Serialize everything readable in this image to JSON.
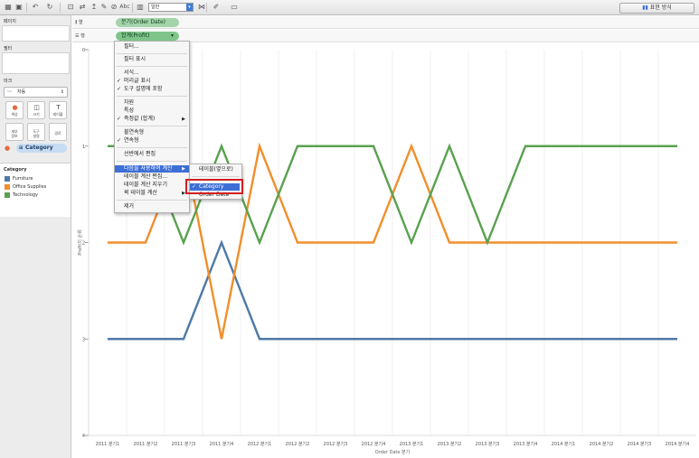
{
  "toolbar": {
    "icons": [
      "data-source-icon",
      "save-icon",
      "undo-icon",
      "redo-icon",
      "new-sheet-icon",
      "swap-icon",
      "sort-asc-icon",
      "sort-desc-icon",
      "highlight-icon",
      "group-icon",
      "label-icon",
      "fit-icon",
      "text-abc-icon",
      "tooltip-icon",
      "pin-icon",
      "pen-icon",
      "presentation-icon"
    ],
    "abc": "Abc",
    "fit_select": "일반",
    "show_me": "표현 방식"
  },
  "left": {
    "pages_title": "페이지",
    "filters_title": "필터",
    "marks_title": "마크",
    "mark_type": "자동",
    "mark_buttons": [
      "색상",
      "크기",
      "레이블",
      "세부\n정보",
      "도구\n설명",
      "경로"
    ],
    "category_pill": "Category",
    "legend_title": "Category",
    "legend": [
      {
        "label": "Furniture",
        "color": "#4e79a7"
      },
      {
        "label": "Office Supplies",
        "color": "#f28e2b"
      },
      {
        "label": "Technology",
        "color": "#59a14f"
      }
    ]
  },
  "shelves": {
    "columns_label": "열",
    "rows_label": "행",
    "columns_pill": "분기(Order Date)",
    "rows_pill": "합계(Profit)",
    "rows_pill_delta": "Δ"
  },
  "menu": {
    "items": [
      "필터...",
      "필터 표시",
      "서식...",
      "머리글 표시",
      "도구 설명에 포함",
      "차원",
      "특성",
      "측정값 (합계)",
      "불연속형",
      "연속형",
      "선반에서 편집",
      "다음을 사용하여 계산",
      "테이블 계산 편집...",
      "테이블 계산 지우기",
      "퀵 테이블 계산",
      "제거"
    ],
    "submenu": [
      "테이블(옆으로)",
      "Category",
      "Order Date"
    ]
  },
  "chart_data": {
    "type": "line",
    "categories": [
      "2011 분기1",
      "2011 분기2",
      "2011 분기3",
      "2011 분기4",
      "2012 분기1",
      "2012 분기2",
      "2012 분기3",
      "2012 분기4",
      "2013 분기1",
      "2013 분기2",
      "2013 분기3",
      "2013 분기4",
      "2014 분기1",
      "2014 분기2",
      "2014 분기3",
      "2014 분기4"
    ],
    "series": [
      {
        "name": "Furniture",
        "color": "#4e79a7",
        "values": [
          3,
          3,
          3,
          2,
          3,
          3,
          3,
          3,
          3,
          3,
          3,
          3,
          3,
          3,
          3,
          3
        ]
      },
      {
        "name": "Office Supplies",
        "color": "#f28e2b",
        "values": [
          2,
          2,
          1,
          3,
          1,
          2,
          2,
          2,
          1,
          2,
          2,
          2,
          2,
          2,
          2,
          2
        ]
      },
      {
        "name": "Technology",
        "color": "#59a14f",
        "values": [
          1,
          1,
          2,
          1,
          2,
          1,
          1,
          1,
          2,
          1,
          2,
          1,
          1,
          1,
          1,
          1
        ]
      }
    ],
    "y_ticks": [
      "0",
      "1",
      "2",
      "3",
      "4"
    ],
    "ylim": [
      0,
      4
    ],
    "ylabel": "Profit의 순위",
    "xlabel": "Order Date 분기",
    "grid": true
  }
}
